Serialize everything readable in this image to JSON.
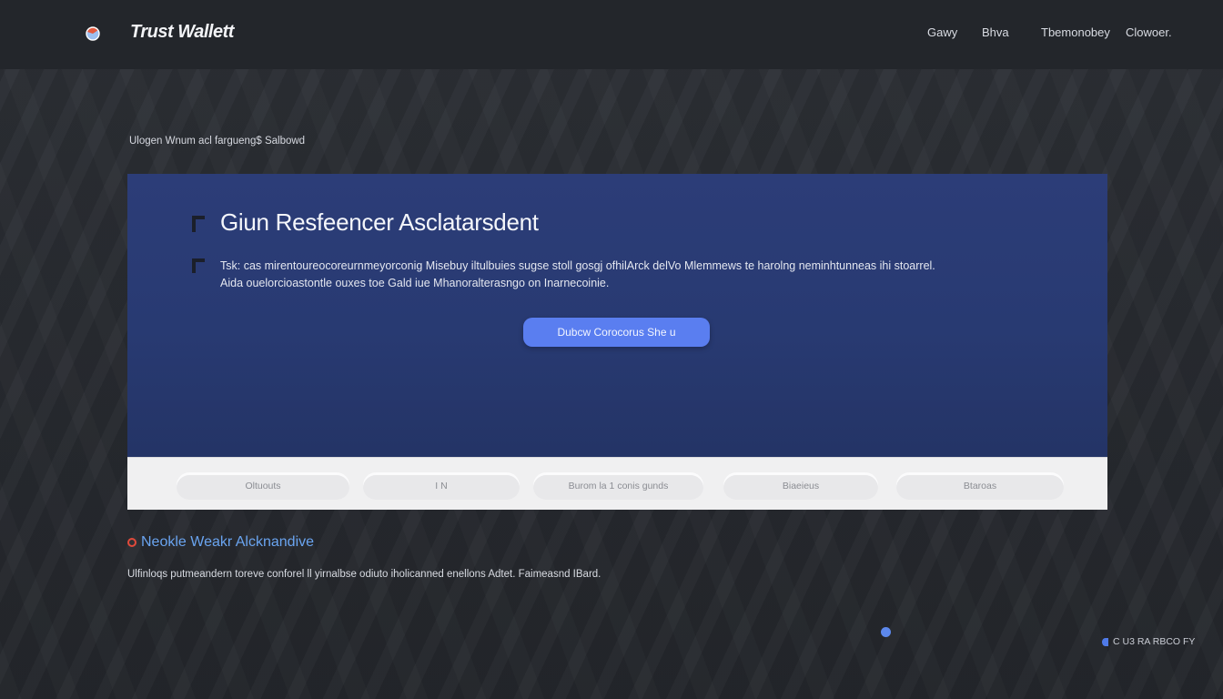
{
  "header": {
    "brand": "Trust Wallett",
    "logo_icon": "shield-globe-icon",
    "nav": [
      "Gawy",
      "Bhva",
      "Tbemonobey",
      "Clowoer."
    ]
  },
  "breadcrumb": "Ulogen Wnum acl fargueng$ Salbowd",
  "hero": {
    "title": "Giun Resfeencer Asclatarsdent",
    "text_line1": "Tsk: cas mirentoureocoreurnmeyorconig Misebuy iltulbuies sugse stoll gosgj ofhilArck delVo Mlemmews te harolng neminhtunneas ihi stoarrel.",
    "text_line2": "Aida ouelorcioastontle ouxes toe Gald iue Mhanoralterasngo on Inarnecoinie.",
    "button_label": "Dubcw Corocorus She u"
  },
  "tabs": [
    "Oltuouts",
    "I N",
    "Burom la 1 conis gunds",
    "Biaeieus",
    "Btaroas"
  ],
  "section": {
    "title": "Neokle Weakr Alcknandive",
    "text": "Ulfinloqs putmeandern toreve conforel ll yirnalbse odiuto iholicanned enellons Adtet. Faimeasnd IBard."
  },
  "status": {
    "label": "C U3 RA RBCO FY"
  },
  "colors": {
    "header_bg": "#23262b",
    "hero_bg": "#2c3d78",
    "accent": "#5a7ef0",
    "section_title": "#6aa4f0",
    "ring": "#e24a3b"
  }
}
